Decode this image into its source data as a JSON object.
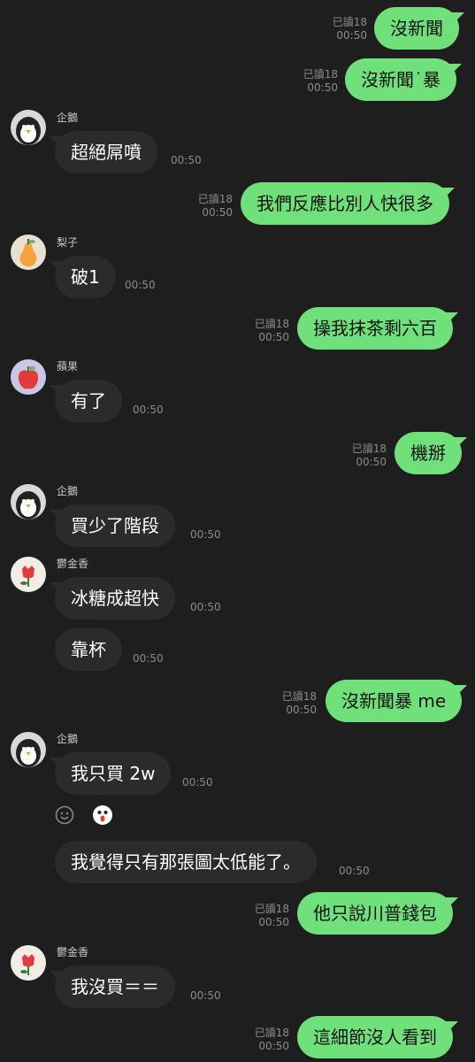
{
  "colors": {
    "background": "#1e1e1e",
    "outgoing": "#6fe07a",
    "incoming": "#2b2b2b",
    "meta": "#8b8b8b"
  },
  "messages": [
    {
      "text": "沒新聞",
      "read": "已讀18",
      "time": "00:50"
    },
    {
      "text": "沒新聞˙暴",
      "read": "已讀18",
      "time": "00:50"
    },
    {
      "sender": "企鵝",
      "text": "超絕屌噴",
      "time": "00:50"
    },
    {
      "text": "我們反應比別人快很多",
      "read": "已讀18",
      "time": "00:50"
    },
    {
      "sender": "梨子",
      "text": "破1",
      "time": "00:50"
    },
    {
      "text": "操我抹茶剩六百",
      "read": "已讀18",
      "time": "00:50"
    },
    {
      "sender": "蘋果",
      "text": "有了",
      "time": "00:50"
    },
    {
      "text": "機掰",
      "read": "已讀18",
      "time": "00:50"
    },
    {
      "sender": "企鵝",
      "text": "買少了階段",
      "time": "00:50"
    },
    {
      "sender": "鬱金香",
      "text": "冰糖成超快",
      "time": "00:50"
    },
    {
      "text": "靠杯",
      "time": "00:50"
    },
    {
      "text": "沒新聞暴 me",
      "read": "已讀18",
      "time": "00:50"
    },
    {
      "sender": "企鵝",
      "text": "我只買 2w",
      "time": "00:50"
    },
    {
      "text": "我覺得只有那張圖太低能了。",
      "time": "00:50"
    },
    {
      "text": "他只說川普錢包",
      "read": "已讀18",
      "time": "00:50"
    },
    {
      "sender": "鬱金香",
      "text": "我沒買＝＝",
      "time": "00:50"
    },
    {
      "text": "這細節沒人看到",
      "read": "已讀18",
      "time": "00:50"
    }
  ],
  "icons": [
    "penguin-avatar-icon",
    "pear-avatar-icon",
    "apple-avatar-icon",
    "tulip-avatar-icon",
    "smiley-react-icon",
    "surprised-sticker-icon"
  ]
}
